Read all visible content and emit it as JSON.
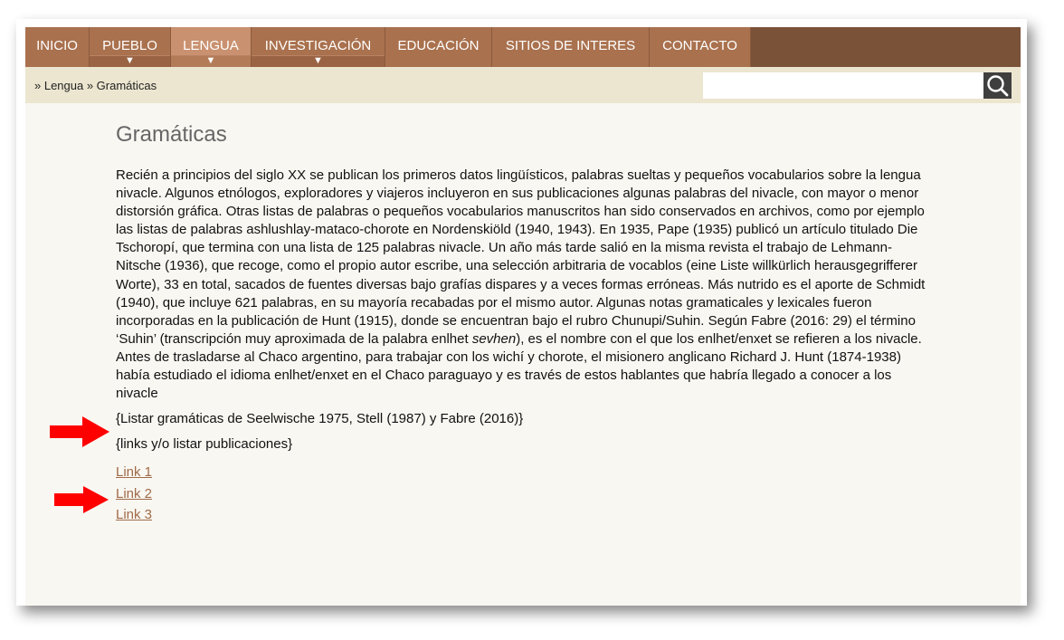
{
  "nav": {
    "items": [
      {
        "label": "INICIO",
        "dropdown": false
      },
      {
        "label": "PUEBLO",
        "dropdown": true
      },
      {
        "label": "LENGUA",
        "dropdown": true,
        "active": true
      },
      {
        "label": "INVESTIGACIÓN",
        "dropdown": true
      },
      {
        "label": "EDUCACIÓN",
        "dropdown": false
      },
      {
        "label": "SITIOS DE INTERES",
        "dropdown": false
      },
      {
        "label": "CONTACTO",
        "dropdown": false
      }
    ],
    "dropdown_glyph": "▼"
  },
  "breadcrumb": "» Lengua » Gramáticas",
  "search": {
    "value": "",
    "placeholder": "",
    "icon": "search-icon"
  },
  "main": {
    "title": "Gramáticas",
    "intro_parts": [
      "Recién a  principios del siglo XX se publican los primeros datos lingüísticos, palabras sueltas y pequeños vocabularios sobre la lengua nivacle. Algunos etnólogos, exploradores y viajeros incluyeron en sus publicaciones algunas palabras del nivacle, con mayor o menor distorsión gráfica. Otras listas de palabras o pequeños vocabularios manuscritos han sido conservados en archivos, como por ejemplo las listas de palabras ashlushlay-mataco-chorote en Nordenskiöld (1940, 1943). En 1935, Pape (1935) publicó un artículo titulado Die Tschoropí, que termina con una lista de 125 palabras nivacle. Un año más tarde salió en la misma revista el trabajo de Lehmann-Nitsche (1936), que recoge, como el propio autor escribe, una selección arbitraria de vocablos (eine Liste willkürlich herausgegrifferer Worte), 33 en total, sacados de fuentes diversas bajo grafías dispares y a veces formas erróneas. Más nutrido es el aporte de Schmidt (1940), que incluye 621 palabras, en su mayoría recabadas por el mismo autor. Algunas notas gramaticales y lexicales fueron incorporadas en la publicación de Hunt (1915), donde se encuentran bajo el rubro Chunupi/Suhin. Según Fabre (2016: 29) el término ‘Suhin’ (transcripción muy aproximada de la palabra enlhet ",
      "sevhen",
      "), es el nombre con el que los enlhet/enxet se refieren a los nivacle. Antes de trasladarse al Chaco argentino, para trabajar con los wichí y chorote, el misionero anglicano Richard J. Hunt (1874-1938) había estudiado el idioma enlhet/enxet en el Chaco paraguayo y es través de estos hablantes que habría llegado a conocer a los nivacle"
    ],
    "placeholder_1": "{Listar gramáticas de Seelwische 1975, Stell (1987) y Fabre (2016)}",
    "placeholder_2": "{links y/o listar publicaciones}",
    "links": [
      "Link 1",
      "Link 2",
      "Link 3"
    ]
  },
  "annotations": {
    "arrow_color": "#ff0000",
    "arrows": [
      "right-arrow",
      "right-arrow"
    ]
  },
  "colors": {
    "nav_bar": "#7a5238",
    "nav_item": "#a9714e",
    "nav_active": "#c9916f",
    "breadcrumb_bar": "#ece6d0",
    "page_background": "#f9f7f2",
    "title": "#666666",
    "link": "#a06a48"
  }
}
